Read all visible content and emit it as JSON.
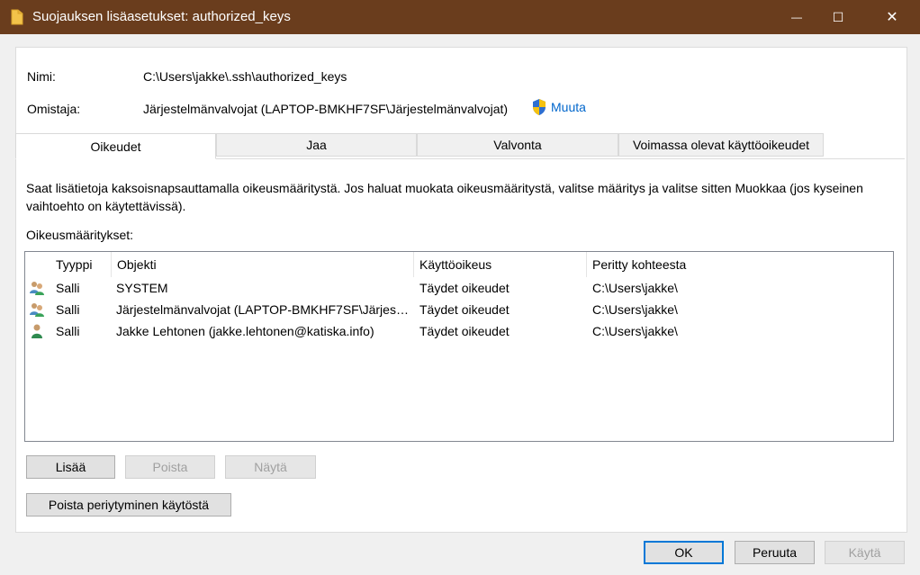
{
  "window": {
    "title": "Suojauksen lisäasetukset: authorized_keys",
    "minimize_glyph": "—",
    "maximize_glyph": "☐",
    "close_glyph": "✕"
  },
  "info": {
    "name_label": "Nimi:",
    "name_value": "C:\\Users\\jakke\\.ssh\\authorized_keys",
    "owner_label": "Omistaja:",
    "owner_value": "Järjestelmänvalvojat (LAPTOP-BMKHF7SF\\Järjestelmänvalvojat)",
    "change_link": "Muuta"
  },
  "tabs": [
    {
      "label": "Oikeudet"
    },
    {
      "label": "Jaa"
    },
    {
      "label": "Valvonta"
    },
    {
      "label": "Voimassa olevat käyttöoikeudet"
    }
  ],
  "description": "Saat lisätietoja kaksoisnapsauttamalla oikeusmääritystä. Jos haluat muokata oikeusmääritystä, valitse määritys ja valitse sitten Muokkaa (jos kyseinen vaihtoehto on käytettävissä).",
  "list_label": "Oikeusmääritykset:",
  "columns": [
    "Tyyppi",
    "Objekti",
    "Käyttöoikeus",
    "Peritty kohteesta"
  ],
  "rows": [
    {
      "icon": "group-users-icon",
      "type": "Salli",
      "object": "SYSTEM",
      "access": "Täydet oikeudet",
      "inherited": "C:\\Users\\jakke\\"
    },
    {
      "icon": "group-users-icon",
      "type": "Salli",
      "object": "Järjestelmänvalvojat (LAPTOP-BMKHF7SF\\Järjes…",
      "access": "Täydet oikeudet",
      "inherited": "C:\\Users\\jakke\\"
    },
    {
      "icon": "user-icon",
      "type": "Salli",
      "object": "Jakke Lehtonen (jakke.lehtonen@katiska.info)",
      "access": "Täydet oikeudet",
      "inherited": "C:\\Users\\jakke\\"
    }
  ],
  "buttons": {
    "add": "Lisää",
    "remove": "Poista",
    "view": "Näytä",
    "disable_inheritance": "Poista periytyminen käytöstä",
    "ok": "OK",
    "cancel": "Peruuta",
    "apply": "Käytä"
  },
  "colors": {
    "titlebar": "#6a3d1d",
    "link": "#0066cc",
    "default_button_border": "#0078d7"
  }
}
